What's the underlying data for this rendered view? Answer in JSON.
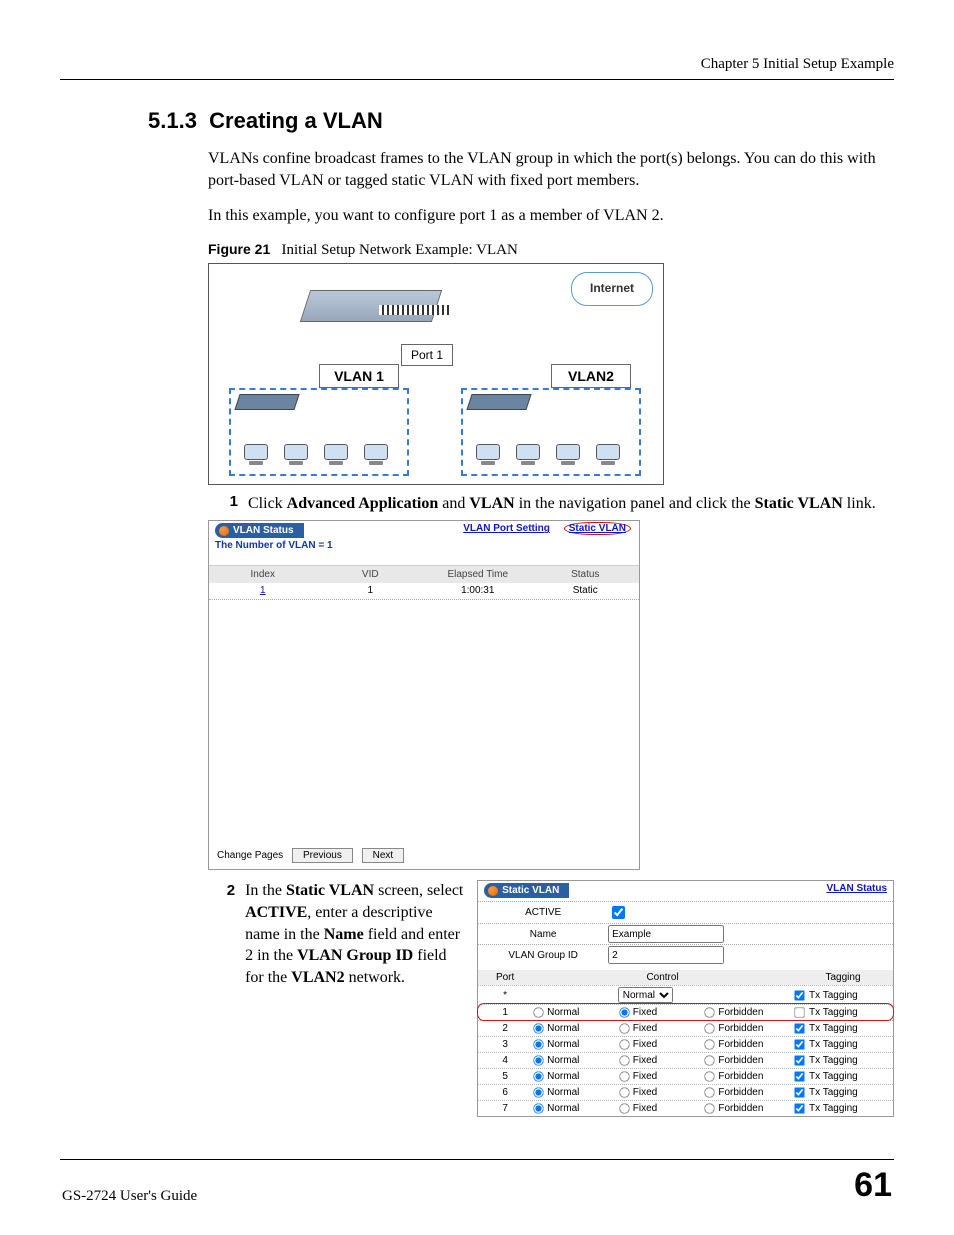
{
  "header": {
    "chapter": "Chapter 5 Initial Setup Example"
  },
  "section": {
    "number": "5.1.3",
    "title": "Creating a VLAN",
    "para1": "VLANs confine broadcast frames to the VLAN group in which the port(s) belongs. You can do this with port-based VLAN or tagged static VLAN with fixed port members.",
    "para2": "In this example, you want to configure port 1 as a member of VLAN 2."
  },
  "figure": {
    "label": "Figure 21",
    "caption": "Initial Setup Network Example: VLAN",
    "internet": "Internet",
    "port": "Port 1",
    "vlan1": "VLAN 1",
    "vlan2": "VLAN2"
  },
  "step1": {
    "num": "1",
    "pre": "Click ",
    "b1": "Advanced Application",
    "mid1": " and ",
    "b2": "VLAN",
    "mid2": " in the navigation panel and click the ",
    "b3": "Static VLAN",
    "post": " link."
  },
  "panel1": {
    "title": "VLAN Status",
    "subtitle": "The Number of VLAN = 1",
    "link_port": "VLAN Port Setting",
    "link_static": "Static VLAN",
    "cols": [
      "Index",
      "VID",
      "Elapsed Time",
      "Status"
    ],
    "row": {
      "index": "1",
      "vid": "1",
      "time": "1:00:31",
      "status": "Static"
    },
    "pager_label": "Change Pages",
    "prev": "Previous",
    "next": "Next"
  },
  "step2": {
    "num": "2",
    "t1": "In the ",
    "b1": "Static VLAN",
    "t2": " screen, select ",
    "b2": "ACTIVE",
    "t3": ", enter a descriptive name in the ",
    "b3": "Name",
    "t4": " field and enter 2 in the ",
    "b4": "VLAN Group ID",
    "t5": " field for the ",
    "b5": "VLAN2",
    "t6": " network."
  },
  "panel2": {
    "title": "Static VLAN",
    "link_status": "VLAN Status",
    "form": {
      "active_label": "ACTIVE",
      "name_label": "Name",
      "name_value": "Example",
      "vlanid_label": "VLAN Group ID",
      "vlanid_value": "2"
    },
    "cols": {
      "port": "Port",
      "control": "Control",
      "tagging": "Tagging"
    },
    "star": "*",
    "dropdown": "Normal",
    "opts": {
      "normal": "Normal",
      "fixed": "Fixed",
      "forbidden": "Forbidden"
    },
    "tx": "Tx Tagging",
    "rows": [
      {
        "port": "1",
        "sel": "fixed",
        "tx": false
      },
      {
        "port": "2",
        "sel": "normal",
        "tx": true
      },
      {
        "port": "3",
        "sel": "normal",
        "tx": true
      },
      {
        "port": "4",
        "sel": "normal",
        "tx": true
      },
      {
        "port": "5",
        "sel": "normal",
        "tx": true
      },
      {
        "port": "6",
        "sel": "normal",
        "tx": true
      },
      {
        "port": "7",
        "sel": "normal",
        "tx": true
      }
    ]
  },
  "footer": {
    "guide": "GS-2724 User's Guide",
    "page": "61"
  }
}
